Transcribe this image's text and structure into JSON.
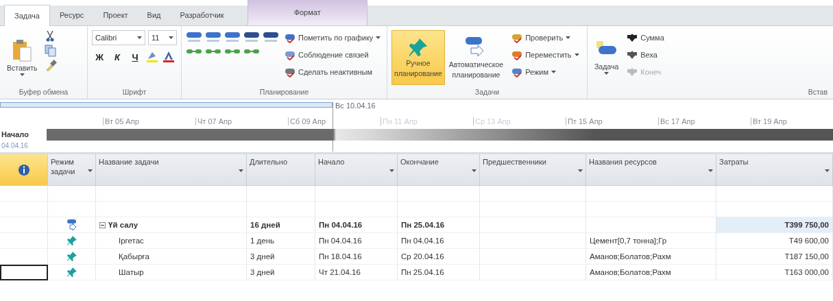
{
  "ribbon_tabs": [
    {
      "label": "Задача",
      "selected": true,
      "kind": "normal"
    },
    {
      "label": "Ресурс",
      "selected": false,
      "kind": "normal"
    },
    {
      "label": "Проект",
      "selected": false,
      "kind": "normal"
    },
    {
      "label": "Вид",
      "selected": false,
      "kind": "normal"
    },
    {
      "label": "Разработчик",
      "selected": false,
      "kind": "normal"
    },
    {
      "label": "Формат",
      "selected": false,
      "kind": "contextual"
    }
  ],
  "clipboard": {
    "paste": "Вставить",
    "label": "Буфер обмена"
  },
  "font": {
    "family": "Calibri",
    "size": "11",
    "bold": "Ж",
    "italic": "К",
    "underline": "Ч",
    "label": "Шрифт"
  },
  "scheduling": {
    "commands": [
      {
        "label": "Пометить по графику",
        "has_menu": true,
        "kind": "mark"
      },
      {
        "label": "Соблюдение связей",
        "has_menu": false,
        "kind": "respect"
      },
      {
        "label": "Сделать неактивным",
        "has_menu": false,
        "kind": "inactive"
      }
    ],
    "label": "Планирование"
  },
  "tasks": {
    "modes": [
      {
        "label": "Ручное планирование",
        "selected": true,
        "kind": "manual"
      },
      {
        "label": "Автоматическое планирование",
        "selected": false,
        "kind": "auto"
      }
    ],
    "commands": [
      {
        "label": "Проверить",
        "has_menu": true,
        "kind": "inspect"
      },
      {
        "label": "Переместить",
        "has_menu": true,
        "kind": "move"
      },
      {
        "label": "Режим",
        "has_menu": true,
        "kind": "mode"
      }
    ],
    "label": "Задачи"
  },
  "insert": {
    "task": "Задача",
    "commands": [
      {
        "label": "Сумма",
        "disabled": false,
        "kind": "summary"
      },
      {
        "label": "Веха",
        "disabled": false,
        "kind": "milestone"
      },
      {
        "label": "Конеч",
        "disabled": true,
        "kind": "deliverable"
      }
    ],
    "label": "Встав"
  },
  "timeline": {
    "start_label": "Начало",
    "start_date": "04.04.16",
    "today": "Вс 10.04.16",
    "ticks": [
      {
        "label": "Вт 05 Апр",
        "faded": false
      },
      {
        "label": "Чт 07 Апр",
        "faded": false
      },
      {
        "label": "Сб 09 Апр",
        "faded": false
      },
      {
        "label": "Пн 11 Апр",
        "faded": true
      },
      {
        "label": "Ср 13 Апр",
        "faded": true
      },
      {
        "label": "Пт 15 Апр",
        "faded": false
      },
      {
        "label": "Вс 17 Апр",
        "faded": false
      },
      {
        "label": "Вт 19 Апр",
        "faded": false
      }
    ]
  },
  "table": {
    "columns": [
      "Режим задачи",
      "Название задачи",
      "Длительно",
      "Начало",
      "Окончание",
      "Предшественники",
      "Названия ресурсов",
      "Затраты"
    ],
    "rows": [
      {
        "kind": "blank"
      },
      {
        "kind": "blank"
      },
      {
        "kind": "summary",
        "manually_scheduled": false,
        "name": "Үй салу",
        "expanded": true,
        "selected": false,
        "duration": "16 дней",
        "start": "Пн 04.04.16",
        "finish": "Пн 25.04.16",
        "resources": "",
        "cost": "Т399 750,00",
        "children": [
          {
            "kind": "task",
            "manually_scheduled": true,
            "name": "Іргетас",
            "selected": false,
            "duration": "1 день",
            "start": "Пн 04.04.16",
            "finish": "Пн 04.04.16",
            "resources": "Цемент[0,7 тонна];Гр",
            "cost": "Т49 600,00"
          },
          {
            "kind": "task",
            "manually_scheduled": true,
            "name": "Қабырға",
            "selected": false,
            "duration": "3 дней",
            "start": "Пн 18.04.16",
            "finish": "Ср 20.04.16",
            "resources": "Аманов;Болатов;Рахм",
            "cost": "Т187 150,00"
          },
          {
            "kind": "task",
            "manually_scheduled": true,
            "name": "Шатыр",
            "selected": true,
            "duration": "3 дней",
            "start": "Чт 21.04.16",
            "finish": "Пн 25.04.16",
            "resources": "Аманов;Болатов;Рахм",
            "cost": "Т163 000,00"
          }
        ]
      }
    ]
  }
}
